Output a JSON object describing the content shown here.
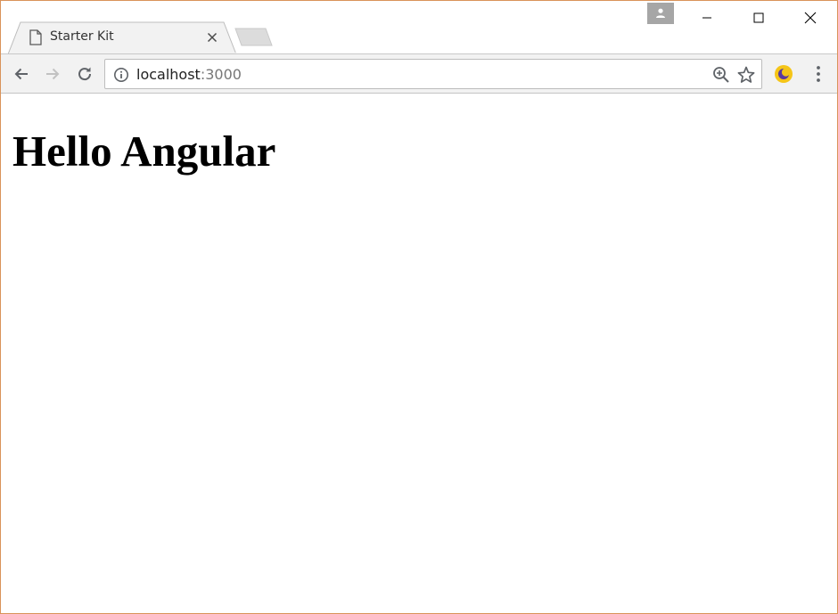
{
  "browser": {
    "tab": {
      "title": "Starter Kit",
      "favicon": "page-icon",
      "close_icon": "close-icon"
    },
    "new_tab_icon": "new-tab-icon",
    "profile_icon": "person-icon",
    "window_controls": [
      "minimize-icon",
      "maximize-icon",
      "close-icon"
    ],
    "toolbar": {
      "back_icon": "back-arrow-icon",
      "forward_icon": "forward-arrow-icon",
      "reload_icon": "reload-icon",
      "extension_icon": "night-mode-extension-icon",
      "menu_icon": "kebab-menu-icon"
    },
    "omnibox": {
      "info_icon": "info-icon",
      "host": "localhost",
      "port": ":3000",
      "zoom_icon": "zoom-icon",
      "bookmark_icon": "star-icon"
    }
  },
  "page": {
    "heading": "Hello Angular"
  },
  "colors": {
    "window_border": "#d9935a",
    "toolbar_bg": "#f2f2f2",
    "extension_yellow": "#f5c518",
    "extension_purple": "#5b3a9e"
  }
}
